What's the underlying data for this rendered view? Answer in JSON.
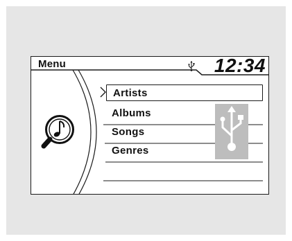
{
  "header": {
    "title": "Menu",
    "clock": "12:34"
  },
  "menu": {
    "items": [
      {
        "label": "Artists",
        "selected": true
      },
      {
        "label": "Albums",
        "selected": false
      },
      {
        "label": "Songs",
        "selected": false
      },
      {
        "label": "Genres",
        "selected": false
      },
      {
        "label": "",
        "selected": false
      }
    ]
  },
  "icons": {
    "status": "usb-icon",
    "source": "music-search-icon",
    "panel": "usb-icon",
    "cursor": "chevron-right-icon"
  },
  "colors": {
    "background": "#e6e6e6",
    "screen": "#ffffff",
    "ink": "#111111",
    "usb_panel": "#bdbdbd"
  }
}
